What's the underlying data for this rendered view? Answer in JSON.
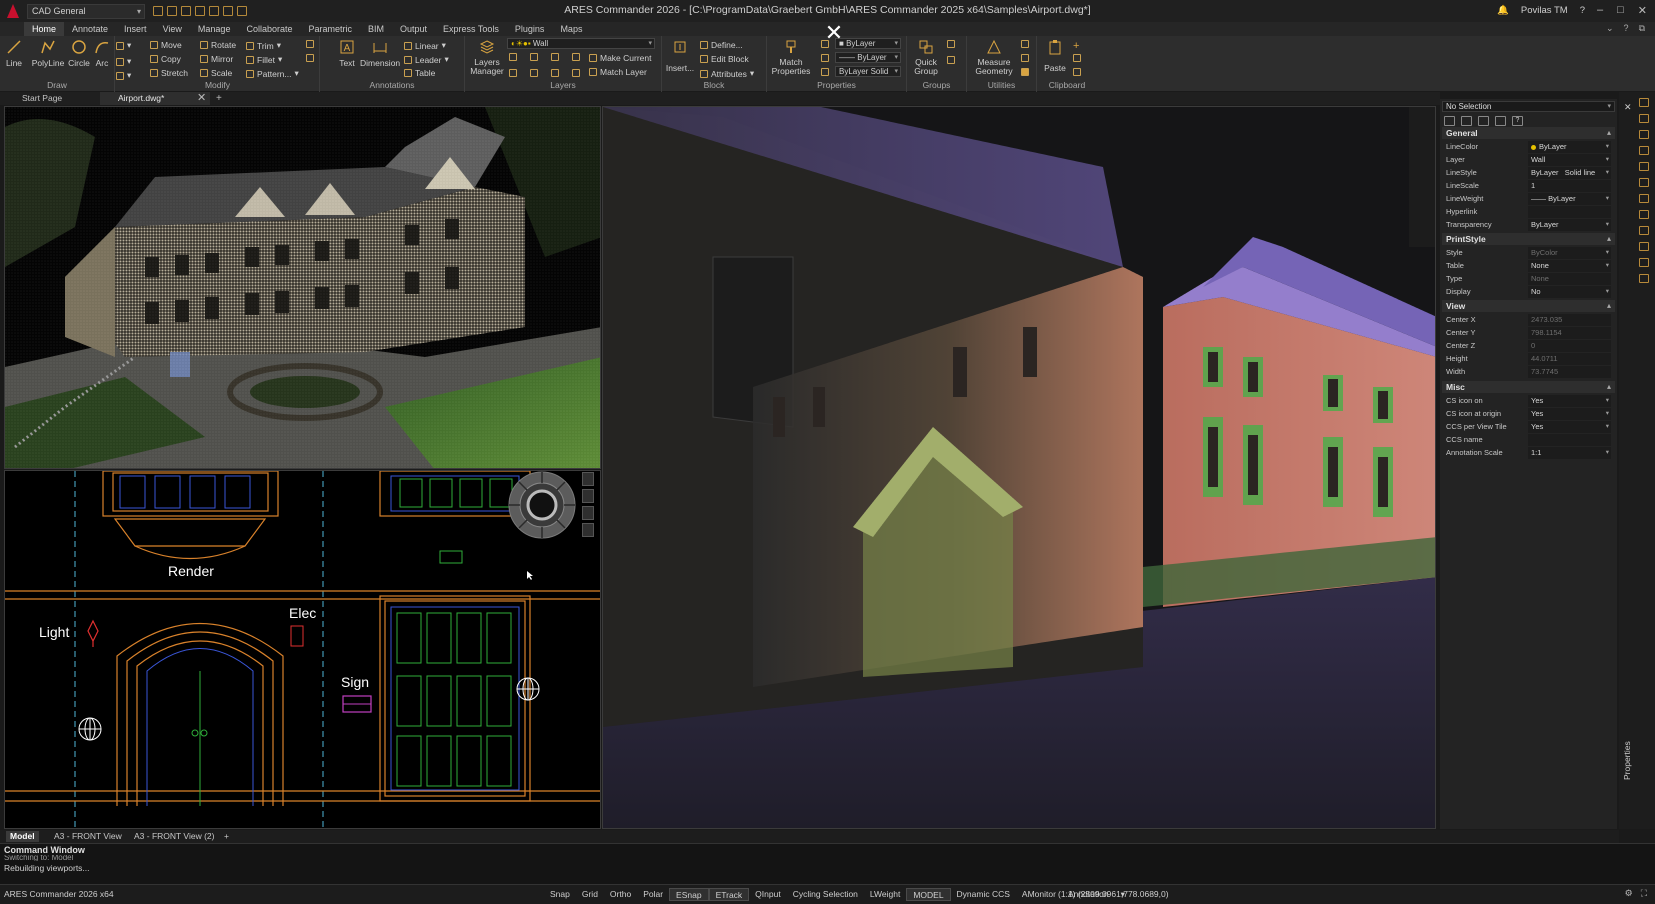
{
  "titlebar": {
    "workspace": "CAD General",
    "title": "ARES Commander 2026 - [C:\\ProgramData\\Graebert GmbH\\ARES Commander 2025 x64\\Samples\\Airport.dwg*]",
    "user": "Povilas TM",
    "help": "?"
  },
  "menu": [
    "Home",
    "Annotate",
    "Insert",
    "View",
    "Manage",
    "Collaborate",
    "Parametric",
    "BIM",
    "Output",
    "Express Tools",
    "Plugins",
    "Maps"
  ],
  "ribbon": {
    "draw": {
      "label": "Draw",
      "tools": [
        "Line",
        "PolyLine",
        "Circle",
        "Arc"
      ]
    },
    "modify": {
      "label": "Modify",
      "tools": [
        "Move",
        "Copy",
        "Stretch",
        "Rotate",
        "Mirror",
        "Scale",
        "Trim",
        "Fillet",
        "Pattern..."
      ]
    },
    "annotations": {
      "label": "Annotations",
      "tools": [
        "Text",
        "Dimension",
        "Linear",
        "Leader",
        "Table"
      ]
    },
    "layers": {
      "label": "Layers",
      "manager": "Layers Manager",
      "current_layer": "Wall",
      "make_current": "Make Current",
      "match_layer": "Match Layer"
    },
    "block": {
      "label": "Block",
      "insert": "Insert...",
      "define": "Define...",
      "edit_block": "Edit Block",
      "attributes": "Attributes"
    },
    "properties": {
      "label": "Properties",
      "match": "Match Properties",
      "color": "ByLayer",
      "linestyle": "ByLayer",
      "lineweight": "ByLayer",
      "solid": "Solid"
    },
    "groups": {
      "label": "Groups",
      "quick_group": "Quick Group"
    },
    "utilities": {
      "label": "Utilities",
      "measure": "Measure Geometry"
    },
    "clipboard": {
      "label": "Clipboard",
      "paste": "Paste"
    }
  },
  "doc_tabs": [
    "Start Page",
    "Airport.dwg*"
  ],
  "cad_labels": {
    "render": "Render",
    "light": "Light",
    "elec": "Elec",
    "sign": "Sign"
  },
  "properties": {
    "selection": "No Selection",
    "sections": {
      "general": "General",
      "printstyle": "PrintStyle",
      "view": "View",
      "misc": "Misc"
    },
    "general_rows": [
      {
        "name": "LineColor",
        "value": "ByLayer"
      },
      {
        "name": "Layer",
        "value": "Wall"
      },
      {
        "name": "LineStyle",
        "value": "ByLayer",
        "extra": "Solid line"
      },
      {
        "name": "LineScale",
        "value": "1"
      },
      {
        "name": "LineWeight",
        "value": "—— ByLayer"
      },
      {
        "name": "Hyperlink",
        "value": ""
      },
      {
        "name": "Transparency",
        "value": "ByLayer"
      }
    ],
    "printstyle_rows": [
      {
        "name": "Style",
        "value": "ByColor"
      },
      {
        "name": "Table",
        "value": "None"
      },
      {
        "name": "Type",
        "value": "None"
      },
      {
        "name": "Display",
        "value": "No"
      }
    ],
    "view_rows": [
      {
        "name": "Center X",
        "value": "2473.035"
      },
      {
        "name": "Center Y",
        "value": "798.1154"
      },
      {
        "name": "Center Z",
        "value": "0"
      },
      {
        "name": "Height",
        "value": "44.0711"
      },
      {
        "name": "Width",
        "value": "73.7745"
      }
    ],
    "misc_rows": [
      {
        "name": "CS icon on",
        "value": "Yes"
      },
      {
        "name": "CS icon at origin",
        "value": "Yes"
      },
      {
        "name": "CCS per View Tile",
        "value": "Yes"
      },
      {
        "name": "CCS name",
        "value": ""
      },
      {
        "name": "Annotation Scale",
        "value": "1:1"
      }
    ],
    "panel_label": "Properties"
  },
  "layout_tabs": [
    "Model",
    "A3 - FRONT View",
    "A3 - FRONT View (2)"
  ],
  "command": {
    "title": "Command Window",
    "line1": "Switching to: Model",
    "line2": "Rebuilding viewports..."
  },
  "status": {
    "app": "ARES Commander 2026 x64",
    "buttons": [
      "Snap",
      "Grid",
      "Ortho",
      "Polar",
      "ESnap",
      "ETrack",
      "QInput",
      "Cycling Selection",
      "LWeight",
      "MODEL",
      "Dynamic CCS",
      "AMonitor",
      "Annotation"
    ],
    "coords": "(1:1) (2509.0961,778.0689,0)"
  },
  "colors": {
    "accent": "#c8102e",
    "cad_orange": "#d9822b",
    "cad_blue": "#3a56d8",
    "cad_green": "#2fae3a"
  }
}
